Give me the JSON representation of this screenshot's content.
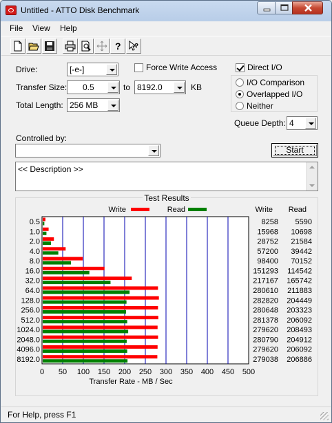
{
  "window": {
    "title": "Untitled - ATTO Disk Benchmark"
  },
  "menu": [
    {
      "label": "File"
    },
    {
      "label": "View"
    },
    {
      "label": "Help"
    }
  ],
  "toolbar": {
    "buttons": [
      "new-icon",
      "open-icon",
      "save-icon",
      "print-icon",
      "print-preview-icon",
      "move-icon",
      "help-icon",
      "context-help-icon"
    ]
  },
  "form": {
    "drive_label": "Drive:",
    "drive_value": "[-e-]",
    "force_write_label": "Force Write Access",
    "force_write_checked": false,
    "direct_io_label": "Direct I/O",
    "direct_io_checked": true,
    "transfer_size_label": "Transfer Size:",
    "transfer_from": "0.5",
    "transfer_to_label": "to",
    "transfer_to": "8192.0",
    "transfer_unit": "KB",
    "total_length_label": "Total Length:",
    "total_length_value": "256 MB",
    "io_options": [
      {
        "label": "I/O Comparison",
        "selected": false
      },
      {
        "label": "Overlapped I/O",
        "selected": true
      },
      {
        "label": "Neither",
        "selected": false
      }
    ],
    "queue_depth_label": "Queue Depth:",
    "queue_depth_value": "4",
    "controlled_by_label": "Controlled by:",
    "controlled_by_value": "",
    "start_button": "Start",
    "description": "<< Description >>"
  },
  "results": {
    "title": "Test Results",
    "legend_write": "Write",
    "legend_read": "Read",
    "col_write": "Write",
    "col_read": "Read",
    "xlabel": "Transfer Rate - MB / Sec"
  },
  "chart_data": {
    "type": "bar",
    "orientation": "horizontal",
    "categories": [
      "0.5",
      "1.0",
      "2.0",
      "4.0",
      "8.0",
      "16.0",
      "32.0",
      "64.0",
      "128.0",
      "256.0",
      "512.0",
      "1024.0",
      "2048.0",
      "4096.0",
      "8192.0"
    ],
    "series": [
      {
        "name": "Write",
        "color": "#ff0000",
        "values": [
          8258,
          15968,
          28752,
          57200,
          98400,
          151293,
          217167,
          280610,
          282820,
          280648,
          281378,
          279620,
          280790,
          279620,
          279038
        ]
      },
      {
        "name": "Read",
        "color": "#008000",
        "values": [
          5590,
          10698,
          21584,
          39442,
          70152,
          114542,
          165742,
          211883,
          204449,
          203323,
          206092,
          208493,
          204912,
          206092,
          206886
        ]
      }
    ],
    "xlabel": "Transfer Rate - MB / Sec",
    "xticks": [
      0,
      50,
      100,
      150,
      200,
      250,
      300,
      350,
      400,
      450,
      500
    ],
    "xlim": [
      0,
      500
    ],
    "value_unit_divisor": 1000,
    "grid": true
  },
  "status": {
    "text": "For Help, press F1"
  }
}
